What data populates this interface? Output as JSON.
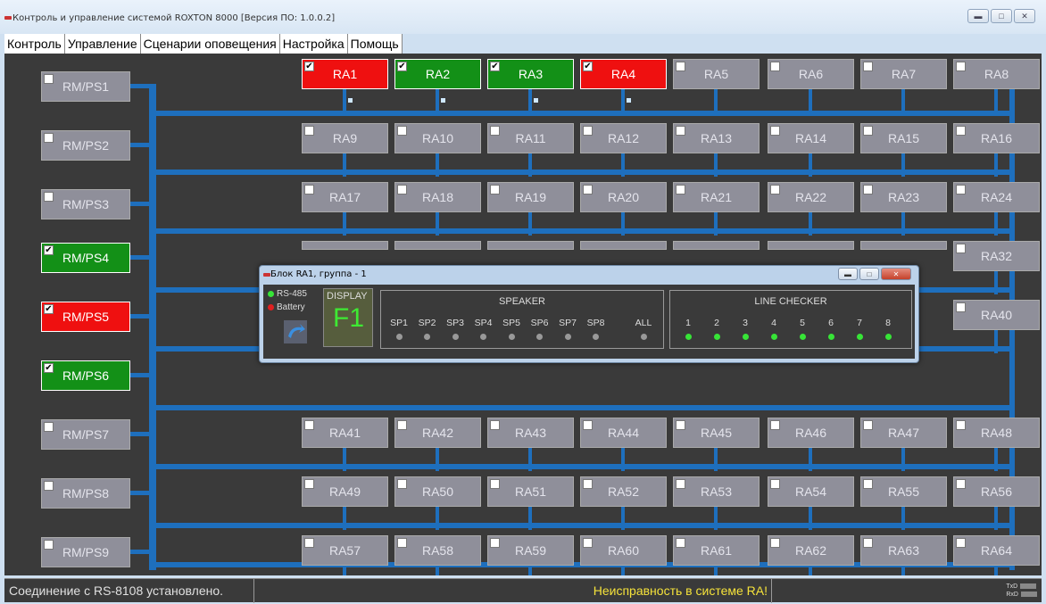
{
  "window": {
    "title": "Контроль и управление системой ROXTON 8000 [Версия ПО: 1.0.0.2]",
    "buttons": [
      "minimize",
      "maximize",
      "close"
    ]
  },
  "tabs": [
    "Контроль",
    "Управление",
    "Сценарии оповещения",
    "Настройка",
    "Помощь"
  ],
  "active_tab": "Контроль",
  "rm_units": [
    {
      "label": "RM/PS1",
      "state": "normal",
      "checked": false
    },
    {
      "label": "RM/PS2",
      "state": "normal",
      "checked": false
    },
    {
      "label": "RM/PS3",
      "state": "normal",
      "checked": false
    },
    {
      "label": "RM/PS4",
      "state": "ok",
      "checked": true
    },
    {
      "label": "RM/PS5",
      "state": "fault",
      "checked": true
    },
    {
      "label": "RM/PS6",
      "state": "ok",
      "checked": true
    },
    {
      "label": "RM/PS7",
      "state": "normal",
      "checked": false
    },
    {
      "label": "RM/PS8",
      "state": "normal",
      "checked": false
    },
    {
      "label": "RM/PS9",
      "state": "normal",
      "checked": false
    }
  ],
  "ra_units": [
    {
      "label": "RA1",
      "state": "fault",
      "checked": true
    },
    {
      "label": "RA2",
      "state": "ok",
      "checked": true
    },
    {
      "label": "RA3",
      "state": "ok",
      "checked": true
    },
    {
      "label": "RA4",
      "state": "fault",
      "checked": true
    },
    {
      "label": "RA5",
      "state": "normal",
      "checked": false
    },
    {
      "label": "RA6",
      "state": "normal",
      "checked": false
    },
    {
      "label": "RA7",
      "state": "normal",
      "checked": false
    },
    {
      "label": "RA8",
      "state": "normal",
      "checked": false
    },
    {
      "label": "RA9"
    },
    {
      "label": "RA10"
    },
    {
      "label": "RA11"
    },
    {
      "label": "RA12"
    },
    {
      "label": "RA13"
    },
    {
      "label": "RA14"
    },
    {
      "label": "RA15"
    },
    {
      "label": "RA16"
    },
    {
      "label": "RA17"
    },
    {
      "label": "RA18"
    },
    {
      "label": "RA19"
    },
    {
      "label": "RA20"
    },
    {
      "label": "RA21"
    },
    {
      "label": "RA22"
    },
    {
      "label": "RA23"
    },
    {
      "label": "RA24"
    },
    {
      "label": "RA32"
    },
    {
      "label": "RA40"
    },
    {
      "label": "RA41"
    },
    {
      "label": "RA42"
    },
    {
      "label": "RA43"
    },
    {
      "label": "RA44"
    },
    {
      "label": "RA45"
    },
    {
      "label": "RA46"
    },
    {
      "label": "RA47"
    },
    {
      "label": "RA48"
    },
    {
      "label": "RA49"
    },
    {
      "label": "RA50"
    },
    {
      "label": "RA51"
    },
    {
      "label": "RA52"
    },
    {
      "label": "RA53"
    },
    {
      "label": "RA54"
    },
    {
      "label": "RA55"
    },
    {
      "label": "RA56"
    },
    {
      "label": "RA57"
    },
    {
      "label": "RA58"
    },
    {
      "label": "RA59"
    },
    {
      "label": "RA60"
    },
    {
      "label": "RA61"
    },
    {
      "label": "RA62"
    },
    {
      "label": "RA63"
    },
    {
      "label": "RA64"
    }
  ],
  "dialog": {
    "title": "Блок RA1, группа - 1",
    "rs485_label": "RS-485",
    "rs485_state": "green",
    "battery_label": "Battery",
    "battery_state": "red",
    "display_label": "DISPLAY",
    "display_value": "F1",
    "speaker_title": "SPEAKER",
    "speakers": [
      "SP1",
      "SP2",
      "SP3",
      "SP4",
      "SP5",
      "SP6",
      "SP7",
      "SP8",
      "ALL"
    ],
    "line_checker_title": "LINE CHECKER",
    "lines": [
      "1",
      "2",
      "3",
      "4",
      "5",
      "6",
      "7",
      "8"
    ]
  },
  "status": {
    "connection": "Соединение с RS-8108 установлено.",
    "alert": "Неисправность в системе RA!",
    "tx": "TxD",
    "rx": "RxD"
  },
  "colors": {
    "fault": "#ef1010",
    "ok": "#139017",
    "normal": "#8f8f9a",
    "bus": "#1e6fbd",
    "alert_text": "#f5e23a"
  }
}
